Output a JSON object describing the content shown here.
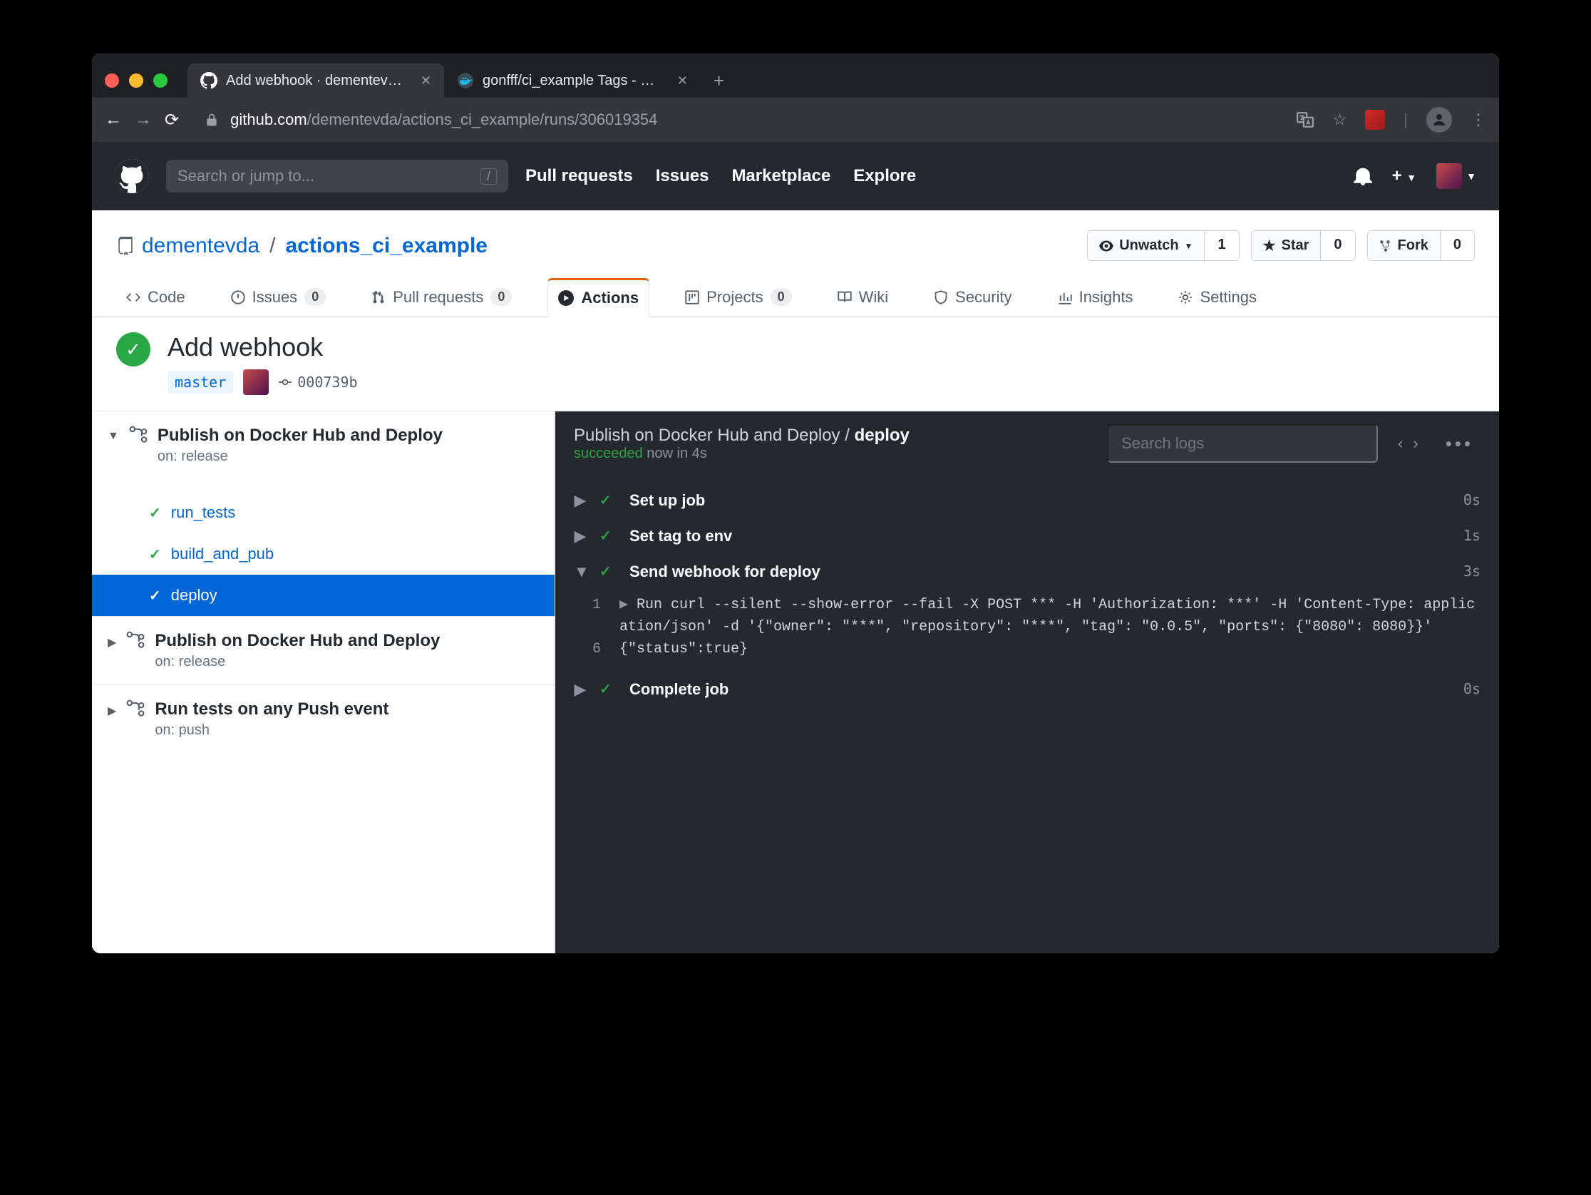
{
  "browser": {
    "tabs": [
      {
        "title": "Add webhook · dementevda/acti",
        "active": true
      },
      {
        "title": "gonfff/ci_example Tags - Docker",
        "active": false
      }
    ],
    "url_domain": "github.com",
    "url_path": "/dementevda/actions_ci_example/runs/306019354"
  },
  "gh_header": {
    "search_placeholder": "Search or jump to...",
    "nav": [
      "Pull requests",
      "Issues",
      "Marketplace",
      "Explore"
    ]
  },
  "repo": {
    "owner": "dementevda",
    "name": "actions_ci_example",
    "buttons": {
      "unwatch": {
        "label": "Unwatch",
        "count": "1"
      },
      "star": {
        "label": "Star",
        "count": "0"
      },
      "fork": {
        "label": "Fork",
        "count": "0"
      }
    },
    "tabs": {
      "code": "Code",
      "issues": "Issues",
      "issues_count": "0",
      "prs": "Pull requests",
      "prs_count": "0",
      "actions": "Actions",
      "projects": "Projects",
      "projects_count": "0",
      "wiki": "Wiki",
      "security": "Security",
      "insights": "Insights",
      "settings": "Settings"
    }
  },
  "run": {
    "title": "Add webhook",
    "branch": "master",
    "commit": "000739b"
  },
  "sidebar": {
    "workflows": [
      {
        "name": "Publish on Docker Hub and Deploy",
        "trigger": "on: release",
        "expanded": true,
        "jobs": [
          {
            "name": "run_tests",
            "active": false
          },
          {
            "name": "build_and_pub",
            "active": false
          },
          {
            "name": "deploy",
            "active": true
          }
        ]
      },
      {
        "name": "Publish on Docker Hub and Deploy",
        "trigger": "on: release",
        "expanded": false,
        "jobs": []
      },
      {
        "name": "Run tests on any Push event",
        "trigger": "on: push",
        "expanded": false,
        "jobs": []
      }
    ]
  },
  "logs": {
    "breadcrumb_wf": "Publish on Docker Hub and Deploy",
    "breadcrumb_job": "deploy",
    "status_word": "succeeded",
    "status_rest": " now in 4s",
    "search_placeholder": "Search logs",
    "steps": [
      {
        "name": "Set up job",
        "time": "0s",
        "expanded": false
      },
      {
        "name": "Set tag to env",
        "time": "1s",
        "expanded": false
      },
      {
        "name": "Send webhook for deploy",
        "time": "3s",
        "expanded": true,
        "lines": [
          {
            "n": "1",
            "prefix": "▶ ",
            "text": "Run curl --silent --show-error --fail -X POST *** -H 'Authorization: ***' -H 'Content-Type: application/json' -d '{\"owner\": \"***\", \"repository\": \"***\", \"tag\": \"0.0.5\", \"ports\": {\"8080\": 8080}}'"
          },
          {
            "n": "6",
            "prefix": "",
            "text": "{\"status\":true}"
          }
        ]
      },
      {
        "name": "Complete job",
        "time": "0s",
        "expanded": false
      }
    ]
  }
}
